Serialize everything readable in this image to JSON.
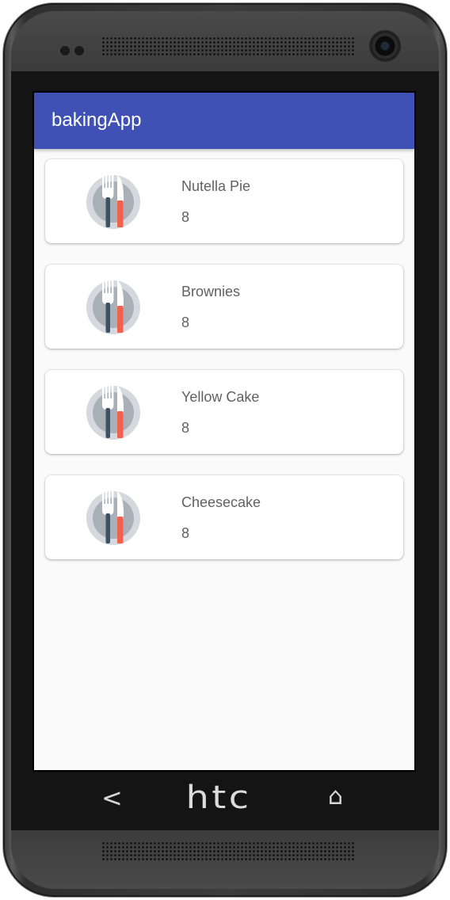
{
  "app": {
    "title": "bakingApp"
  },
  "recipes": [
    {
      "name": "Nutella Pie",
      "servings": "8",
      "icon": "cutlery-plate-icon"
    },
    {
      "name": "Brownies",
      "servings": "8",
      "icon": "cutlery-plate-icon"
    },
    {
      "name": "Yellow Cake",
      "servings": "8",
      "icon": "cutlery-plate-icon"
    },
    {
      "name": "Cheesecake",
      "servings": "8",
      "icon": "cutlery-plate-icon"
    }
  ],
  "device": {
    "brand": "htc",
    "back_glyph": "<",
    "home_glyph": "⌂"
  },
  "colors": {
    "app_bar": "#3f51b5",
    "background": "#fafafa",
    "knife_accent": "#f0624d",
    "fork": "#3e5163"
  }
}
